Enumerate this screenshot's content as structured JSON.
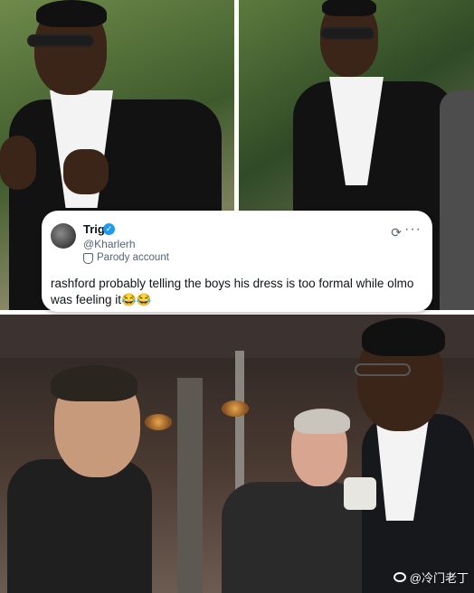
{
  "tweet": {
    "name": "Trig",
    "handle": "@Kharlerh",
    "parody_label": "Parody account",
    "text": "rashford probably telling the boys his dress is too formal while olmo was feeling it😂😂",
    "more_glyph": "···",
    "grok_glyph": "⟳",
    "verified_glyph": "✓"
  },
  "watermark": {
    "text": "@冷门老丁"
  },
  "photos": {
    "top_left": "rashford-laughing-photo",
    "top_right": "rashford-smiling-photo",
    "bottom": "rashford-olmo-photo"
  },
  "colors": {
    "verified": "#1d9bf0",
    "text": "#0f1419",
    "muted": "#536471",
    "card_bg": "#ffffff"
  }
}
